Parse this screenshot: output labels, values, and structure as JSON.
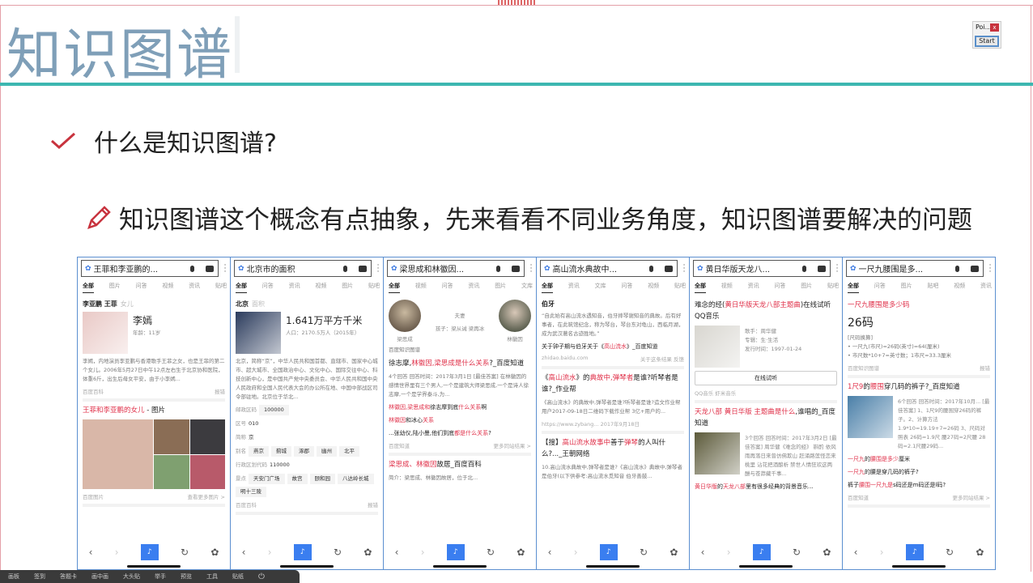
{
  "slide": {
    "title": "知识图谱",
    "bullet1": "什么是知识图谱?",
    "bullet2": "知识图谱这个概念有点抽象，先来看看不同业务角度，知识图谱要解决的问题",
    "accent": "#3cb7b0",
    "bullet_color": "#c8333e"
  },
  "popup": {
    "title": "Poi...",
    "close": "x",
    "start": "Start"
  },
  "toolbar": [
    "画板",
    "签到",
    "答题卡",
    "画中画",
    "大头贴",
    "举手",
    "预览",
    "工具",
    "贴纸"
  ],
  "phones": [
    {
      "query": "王菲和李亚鹏的...",
      "tabs": [
        "全部",
        "图片",
        "问答",
        "视频",
        "资讯",
        "贴吧"
      ],
      "blocks": [
        {
          "type": "crumb",
          "a": "李亚鹏  王菲",
          "b": "女儿"
        },
        {
          "type": "entity",
          "name": "李嫣",
          "sub": "年龄：11岁",
          "img": "#e9c9c6"
        },
        {
          "type": "para",
          "text": "李嫣，内地演员李亚鹏与香港歌手王菲之女，也是王菲的第二个女儿。2006年5月27日中午12点左右生于北京协和医院，体重6斤，出生后母女平安，由于小李嫣..."
        },
        {
          "type": "foot",
          "l": "百度百科",
          "r": "报错"
        },
        {
          "type": "head",
          "segs": [
            {
              "t": "王菲和李亚鹏的女儿",
              "r": true
            },
            {
              "t": " - 图片"
            }
          ]
        },
        {
          "type": "grid"
        },
        {
          "type": "foot",
          "l": "百度图片",
          "r": "查看更多图片 >"
        }
      ]
    },
    {
      "query": "北京市的面积",
      "tabs": [
        "全部",
        "问答",
        "资讯",
        "视频",
        "图片",
        "贴吧"
      ],
      "blocks": [
        {
          "type": "crumb",
          "a": "北京",
          "b": "面积"
        },
        {
          "type": "entity",
          "name": "1.641万平方千米",
          "sub": "人口：2170.5万人（2015年）",
          "img": "#2b3b5c"
        },
        {
          "type": "para",
          "text": "北京，简称“京”，中华人民共和国首都、直辖市、国家中心城市、超大城市、全国政治中心、文化中心、国际交往中心、科技创新中心，是中国共产党中央委员会、中华人民共和国中央人民政府和全国人民代表大会的办公所在地、中国中部战区司令部驻地。北京位于华北..."
        },
        {
          "type": "kv",
          "label": "邮政区码",
          "chips": [
            "100000"
          ]
        },
        {
          "type": "kv",
          "label": "区号",
          "value": "010"
        },
        {
          "type": "kv",
          "label": "简称",
          "value": "京"
        },
        {
          "type": "kv",
          "label": "别名",
          "chips": [
            "燕京",
            "蓟城",
            "涿郡",
            "幽州",
            "北平"
          ]
        },
        {
          "type": "kv",
          "label": "行政区划代码",
          "value": "110000"
        },
        {
          "type": "kv",
          "label": "景点",
          "chips": [
            "天安门广场",
            "故宫",
            "颐和园",
            "八达岭长城",
            "明十三陵"
          ]
        },
        {
          "type": "foot",
          "l": "百度百科",
          "r": "报错"
        }
      ]
    },
    {
      "query": "梁思成和林徽因...",
      "tabs": [
        "全部",
        "视频",
        "问答",
        "资讯",
        "图片",
        "文库"
      ],
      "blocks": [
        {
          "type": "couple",
          "left": "梁思成",
          "right": "林徽因",
          "rel": "夫妻",
          "kids": "孩子：梁从诫 梁再冰"
        },
        {
          "type": "para",
          "text": "百度知识图谱"
        },
        {
          "type": "head",
          "segs": [
            {
              "t": "徐志摩,"
            },
            {
              "t": "林徽因,梁思成是什么关系",
              "r": true
            },
            {
              "t": "?_百度知道"
            }
          ]
        },
        {
          "type": "para",
          "text": "4个回答  回答时间：2017年3月1日  [最佳答案] 在林徽因的感情世界里有三个男人,一个是建筑大师梁思成,一个是诗人徐志摩,一个是学界泰斗,为..."
        },
        {
          "type": "head",
          "segs": [
            {
              "t": "林徽因,梁思成和",
              "r": true
            },
            {
              "t": "徐志摩到底"
            },
            {
              "t": "什么关系",
              "r": true
            },
            {
              "t": "啊"
            }
          ],
          "small": true
        },
        {
          "type": "head",
          "segs": [
            {
              "t": "林徽因",
              "r": true
            },
            {
              "t": "和冰心"
            },
            {
              "t": "关系",
              "r": true
            }
          ],
          "small": true
        },
        {
          "type": "head",
          "segs": [
            {
              "t": "...张幼仪,陆小曼,他们到底"
            },
            {
              "t": "都是什么关系",
              "r": true
            },
            {
              "t": "?"
            }
          ],
          "small": true
        },
        {
          "type": "foot",
          "l": "百度知道",
          "r": "更多同站结果 >"
        },
        {
          "type": "head",
          "segs": [
            {
              "t": "梁思成、林徽因",
              "r": true
            },
            {
              "t": "故居_百度百科"
            }
          ]
        },
        {
          "type": "para",
          "text": "简介：梁思成、林徽因故居，位于北..."
        }
      ]
    },
    {
      "query": "高山流水典故中...",
      "tabs": [
        "全部",
        "资讯",
        "文库",
        "问答",
        "视频",
        "贴吧"
      ],
      "blocks": [
        {
          "type": "crumb",
          "a": "伯牙",
          "b": ""
        },
        {
          "type": "para",
          "text": "“自此始有高山流水遇知音，伯牙摔琴谢知音的典故。后有好事者，在此筑馆纪念，称为琴台，琴台东对龟山，西临月湖，成为武汉著名古迹胜地。”"
        },
        {
          "type": "head",
          "segs": [
            {
              "t": "关于钟子期与伯牙关于《"
            },
            {
              "t": "高山流水",
              "r": true
            },
            {
              "t": "》_百度知道"
            }
          ],
          "small": true
        },
        {
          "type": "foot",
          "l": "zhidao.baidu.com",
          "r": "关于这条结果  反馈"
        },
        {
          "type": "head",
          "segs": [
            {
              "t": "《"
            },
            {
              "t": "高山流水",
              "r": true
            },
            {
              "t": "》的"
            },
            {
              "t": "典故中,弹琴者",
              "r": true
            },
            {
              "t": "是谁?听琴者是谁?_作业帮"
            }
          ]
        },
        {
          "type": "para",
          "text": "《高山流水》的典故中,弹琴者是谁?听琴者是谁?造文作业帮用户2017-09-18日二维码下载作业帮 3亿+用户的..."
        },
        {
          "type": "foot",
          "l": "https://www.zybang...  2017年9月18日",
          "r": ""
        },
        {
          "type": "head",
          "segs": [
            {
              "t": "【搜】"
            },
            {
              "t": "高山流水故事中",
              "r": true
            },
            {
              "t": "善于"
            },
            {
              "t": "弹琴",
              "r": true
            },
            {
              "t": "的人叫什么?..._王朝网络"
            }
          ]
        },
        {
          "type": "para",
          "text": "10.高山流水典故中,弹琴者是谁?《高山流水》典故中,弹琴者是伯牙(以下供参考:高山流水觅知音 伯牙善鼓..."
        }
      ]
    },
    {
      "query": "黄日华版天龙八...",
      "tabs": [
        "全部",
        "视频",
        "资讯",
        "问答",
        "图片",
        "贴吧"
      ],
      "blocks": [
        {
          "type": "head",
          "segs": [
            {
              "t": "难念的经("
            },
            {
              "t": "黄日华版天龙八部主题曲",
              "r": true
            },
            {
              "t": ")在线试听QQ音乐"
            }
          ]
        },
        {
          "type": "entity",
          "name": "",
          "sub": "歌手：周华健\n专辑：生·生活\n发行时间：1997-01-24",
          "img": "#d8d6d0"
        },
        {
          "type": "btn",
          "text": "在线试听"
        },
        {
          "type": "foot",
          "l": "QQ音乐   虾米音乐",
          "r": ""
        },
        {
          "type": "head",
          "segs": [
            {
              "t": "天龙八部 黄日华版 主题曲是什么",
              "r": true
            },
            {
              "t": ",谁唱的_百度知道"
            }
          ]
        },
        {
          "type": "entity",
          "name": "",
          "sub": "3个回答  回答时间：2017年3月2日 [最佳答案] 周华健《难念的经》 斟酌 依风雨再落日来曾仿佛欺山 赶涌路莲怪恋来桃里 沾花把酒酿析 禁世人情狂欢这两酬与苍莽藏千事...",
          "img": "#5c5a3a"
        },
        {
          "type": "head",
          "segs": [
            {
              "t": "黄日华版",
              "r": true
            },
            {
              "t": "的"
            },
            {
              "t": "天龙八部",
              "r": true
            },
            {
              "t": "里有很多经典的背景音乐..."
            }
          ],
          "small": true
        }
      ]
    },
    {
      "query": "一尺九腰围是多...",
      "tabs": [
        "全部",
        "问答",
        "图片",
        "贴吧",
        "视频",
        "资讯"
      ],
      "blocks": [
        {
          "type": "head",
          "segs": [
            {
              "t": "一尺九腰围是多少码",
              "r": true
            }
          ]
        },
        {
          "type": "crumb",
          "a": "26码",
          "b": "",
          "big": true
        },
        {
          "type": "para",
          "text": "[尺码换算]\n• 一尺九(市尺)=26码(英寸)=64(厘米)\n• 市尺数*10+7=英寸数；1市尺=33.3厘米"
        },
        {
          "type": "foot",
          "l": "百度知识图谱",
          "r": "报错"
        },
        {
          "type": "head",
          "segs": [
            {
              "t": "1尺9",
              "r": true
            },
            {
              "t": "的"
            },
            {
              "t": "腰围",
              "r": true
            },
            {
              "t": "穿几码的裤子?_百度知道"
            }
          ]
        },
        {
          "type": "entity",
          "name": "",
          "sub": "6个回答  回答时间：2017年10月... [最佳答案] 1、1尺9的腰围穿26码的裤子。2、计算方法 1.9*10=19.19+7=26码 3、尺码对照表 26码=1.9尺 腰27码=2尺腰 28码=2.1尺腰29码...",
          "img": "#4a7fa8"
        },
        {
          "type": "head",
          "segs": [
            {
              "t": "一尺九",
              "r": true
            },
            {
              "t": "的"
            },
            {
              "t": "腰围是多少",
              "r": true
            },
            {
              "t": "厘米"
            }
          ],
          "small": true
        },
        {
          "type": "head",
          "segs": [
            {
              "t": "一尺九",
              "r": true
            },
            {
              "t": "的腰是穿几码的裤子?"
            }
          ],
          "small": true
        },
        {
          "type": "head",
          "segs": [
            {
              "t": "裤子"
            },
            {
              "t": "腰围一尺九是",
              "r": true
            },
            {
              "t": "s码还是m码还是l码?"
            }
          ],
          "small": true
        },
        {
          "type": "foot",
          "l": "百度知道",
          "r": "更多同站结果 >"
        }
      ]
    }
  ]
}
